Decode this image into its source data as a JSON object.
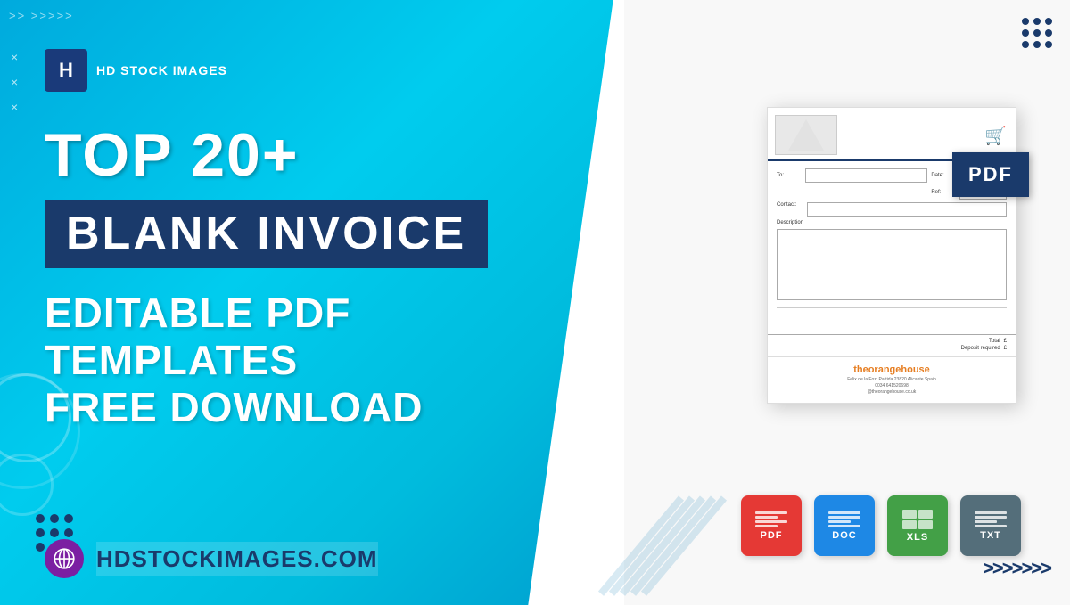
{
  "brand": {
    "logo_letter": "H",
    "name": "HD STOCK IMAGES",
    "website": "HDSTOCKIMAGES.COM"
  },
  "headline": {
    "top": "TOP 20+",
    "highlight": "BLANK INVOICE",
    "subtitle_line1": "EDITABLE PDF TEMPLATES",
    "subtitle_line2": "FREE DOWNLOAD"
  },
  "invoice": {
    "pdf_badge": "PDF",
    "company_name_plain": "the",
    "company_name_orange": "orange",
    "company_name_end": "house",
    "address_line1": "Felix de la Foz, Partida 23820 Alicante Spain",
    "address_line2": "0034 641520698",
    "address_line3": "@theorangehouse.co.uk",
    "fields": {
      "to_label": "To:",
      "date_label": "Date:",
      "ref_label": "Ref:",
      "contact_label": "Contact:",
      "description_label": "Description",
      "total_label": "Total",
      "deposit_label": "Deposit required",
      "currency": "£"
    }
  },
  "formats": [
    {
      "id": "pdf",
      "label": "PDF",
      "color": "#e53935"
    },
    {
      "id": "doc",
      "label": "DOC",
      "color": "#1e88e5"
    },
    {
      "id": "xls",
      "label": "XLS",
      "color": "#43a047"
    },
    {
      "id": "txt",
      "label": "TXT",
      "color": "#546e7a"
    }
  ],
  "decorations": {
    "arrows_top": ">> >>>>>",
    "arrows_bottom_right": ">>>>>>>",
    "x_marks": [
      "×",
      "×",
      "×"
    ]
  }
}
